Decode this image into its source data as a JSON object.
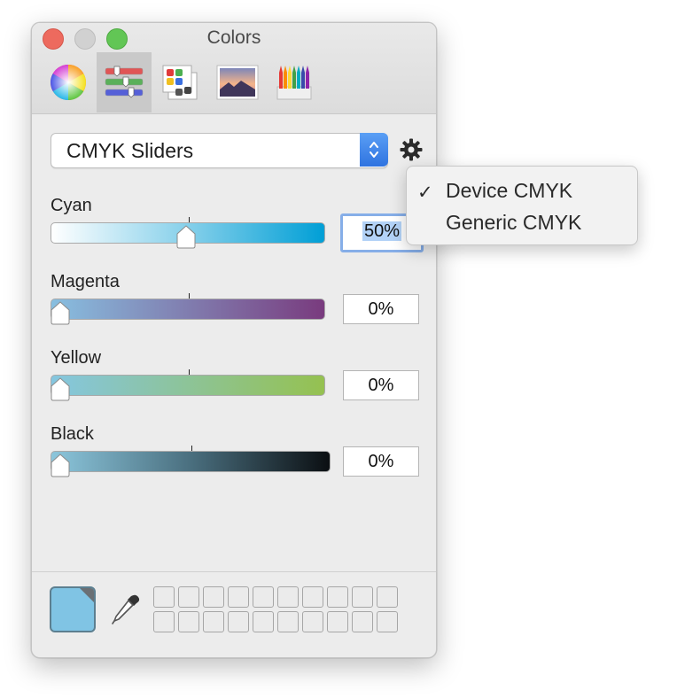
{
  "window": {
    "title": "Colors",
    "toolbar": [
      {
        "icon": "color-wheel-icon",
        "selected": false
      },
      {
        "icon": "sliders-icon",
        "selected": true
      },
      {
        "icon": "color-palettes-icon",
        "selected": false
      },
      {
        "icon": "image-palettes-icon",
        "selected": false
      },
      {
        "icon": "pencils-icon",
        "selected": false
      }
    ]
  },
  "mode_popup": {
    "selected": "CMYK Sliders"
  },
  "sliders": [
    {
      "label": "Cyan",
      "value": "50%",
      "level": 0.5
    },
    {
      "label": "Magenta",
      "value": "0%",
      "level": 0
    },
    {
      "label": "Yellow",
      "value": "0%",
      "level": 0
    },
    {
      "label": "Black",
      "value": "0%",
      "level": 0
    }
  ],
  "profile_menu": {
    "check": "✓",
    "items": [
      {
        "label": "Device CMYK",
        "checked": true
      },
      {
        "label": "Generic CMYK",
        "checked": false
      }
    ]
  },
  "current_color": "#80c4e4",
  "colors": {
    "cyan": "#009fd6",
    "magenta": "#793b7e",
    "yellow": "#95c150",
    "accent": "#2f73e0"
  }
}
